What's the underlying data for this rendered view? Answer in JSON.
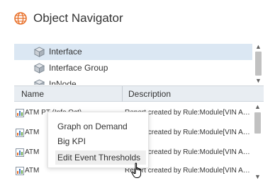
{
  "panel": {
    "title": "Object Navigator",
    "icon": "globe-icon",
    "accent_color": "#e8702a"
  },
  "tree": {
    "items": [
      {
        "label": "Interface",
        "icon": "cube-icon",
        "selected": true
      },
      {
        "label": "Interface Group",
        "icon": "cube-icon",
        "selected": false
      },
      {
        "label": "InNode",
        "icon": "cube-icon",
        "selected": false
      }
    ]
  },
  "table": {
    "columns": [
      "Name",
      "Description"
    ],
    "rows": [
      {
        "name": "ATM PT (Info Oct)",
        "description": "Report created by Rule:Module[VIN A…"
      },
      {
        "name": "ATM",
        "description": "Report created by Rule:Module[VIN A…"
      },
      {
        "name": "ATM",
        "description": "Report created by Rule:Module[VIN A…"
      },
      {
        "name": "ATM",
        "description": "Report created by Rule:Module[VIN A…"
      }
    ]
  },
  "context_menu": {
    "items": [
      {
        "label": "Graph on Demand"
      },
      {
        "label": "Big KPI"
      },
      {
        "label": "Edit Event Thresholds"
      }
    ]
  }
}
